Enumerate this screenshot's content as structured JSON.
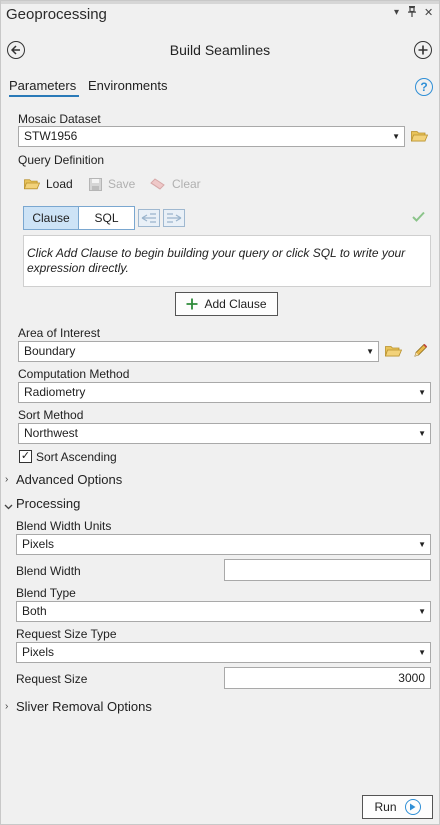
{
  "pane": {
    "title": "Geoprocessing",
    "pin_glyph": "▾",
    "autohide_glyph": "⊥",
    "close_glyph": "✕"
  },
  "tool": {
    "title": "Build Seamlines"
  },
  "tabs": {
    "parameters": "Parameters",
    "environments": "Environments",
    "help_glyph": "?"
  },
  "params": {
    "mosaic_dataset_label": "Mosaic Dataset",
    "mosaic_dataset_value": "STW1956",
    "query_definition_label": "Query Definition",
    "load_label": "Load",
    "save_label": "Save",
    "clear_label": "Clear",
    "clause_tab": "Clause",
    "sql_tab": "SQL",
    "query_hint": "Click Add Clause to begin building your query or click SQL to write your expression directly.",
    "add_clause_label": "Add Clause",
    "aoi_label": "Area of Interest",
    "aoi_value": "Boundary",
    "computation_label": "Computation Method",
    "computation_value": "Radiometry",
    "sort_method_label": "Sort Method",
    "sort_method_value": "Northwest",
    "sort_ascending_label": "Sort Ascending",
    "sort_ascending_checked": true
  },
  "sections": {
    "advanced": "Advanced Options",
    "processing": "Processing",
    "sliver": "Sliver Removal Options"
  },
  "processing": {
    "blend_width_units_label": "Blend Width Units",
    "blend_width_units_value": "Pixels",
    "blend_width_label": "Blend Width",
    "blend_width_value": "",
    "blend_type_label": "Blend Type",
    "blend_type_value": "Both",
    "request_size_type_label": "Request Size Type",
    "request_size_type_value": "Pixels",
    "request_size_label": "Request Size",
    "request_size_value": "3000"
  },
  "footer": {
    "run_label": "Run"
  },
  "colors": {
    "accent": "#2a7ab8",
    "folder": "#e0b040",
    "add_green": "#2e8b3a",
    "check_green": "#8bc48a"
  },
  "icons": [
    "back-arrow-icon",
    "add-circle-icon",
    "help-icon",
    "folder-icon",
    "save-disk-icon",
    "eraser-icon",
    "pencil-icon",
    "check-icon",
    "dropdown-arrow-icon",
    "chevron-right-icon",
    "chevron-down-icon",
    "run-play-icon"
  ]
}
